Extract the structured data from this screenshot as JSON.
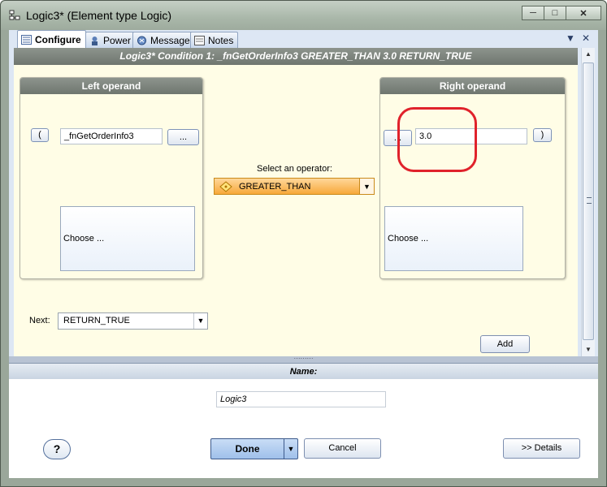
{
  "window": {
    "title": "Logic3* (Element type Logic)",
    "controls": [
      "minimize",
      "maximize",
      "close"
    ]
  },
  "tabs": [
    {
      "label": "Configure",
      "icon": "configure-icon",
      "active": true
    },
    {
      "label": "Power",
      "icon": "power-icon",
      "active": false
    },
    {
      "label": "Message",
      "icon": "message-icon",
      "active": false
    },
    {
      "label": "Notes",
      "icon": "notes-icon",
      "active": false
    }
  ],
  "condition_header": "Logic3*  Condition 1:  _fnGetOrderInfo3 GREATER_THAN 3.0  RETURN_TRUE",
  "left_operand": {
    "title": "Left operand",
    "open_paren": "(",
    "value": "_fnGetOrderInfo3",
    "browse_label": "...",
    "choose_label": "Choose ..."
  },
  "operator": {
    "label": "Select an operator:",
    "value": "GREATER_THAN"
  },
  "right_operand": {
    "title": "Right operand",
    "browse_label": "...",
    "value": "3.0",
    "close_paren": ")",
    "choose_label": "Choose ..."
  },
  "next": {
    "label": "Next:",
    "value": "RETURN_TRUE"
  },
  "add_label": "Add",
  "name_section": {
    "header": "Name:",
    "value": "Logic3"
  },
  "buttons": {
    "help": "?",
    "done": "Done",
    "cancel": "Cancel",
    "details": ">> Details"
  },
  "colors": {
    "annotation": "#e0222b",
    "operator_accent": "#f7a83a",
    "panel_background": "#fffde6"
  }
}
